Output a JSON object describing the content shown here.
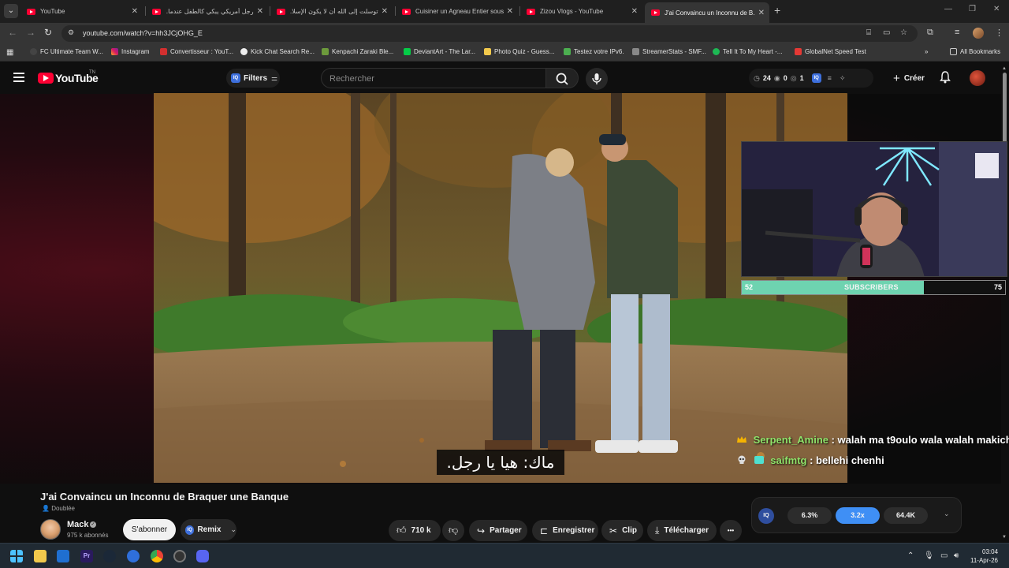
{
  "browser": {
    "tabs": [
      {
        "title": "YouTube",
        "active": false
      },
      {
        "title": "رجل أمريكي يبكي كالطفل عندما...",
        "active": false
      },
      {
        "title": "توسلت إلى الله أن لا يكون الإسلا...",
        "active": false
      },
      {
        "title": "Cuisiner un Agneau Entier sous...",
        "active": false
      },
      {
        "title": "Zizou Vlogs - YouTube",
        "active": false
      },
      {
        "title": "J'ai Convaincu un Inconnu de B...",
        "active": true
      }
    ],
    "new_tab": "+",
    "url": "youtube.com/watch?v=hh3JCjOHG_E",
    "bookmarks": [
      "FC Ultimate Team W...",
      "Instagram",
      "Convertisseur : YouT...",
      "Kick Chat Search Re...",
      "Kenpachi Zaraki Ble...",
      "DeviantArt - The Lar...",
      "Photo Quiz - Guess...",
      "Testez votre IPv6.",
      "StreamerStats - SMF...",
      "Tell It To My Heart -...",
      "GlobalNet Speed Test"
    ],
    "all_bookmarks": "All Bookmarks"
  },
  "masthead": {
    "logo_text": "YouTube",
    "country": "TN",
    "filters": "Filters",
    "search_placeholder": "Rechercher",
    "stats": {
      "a": "24",
      "b": "0",
      "c": "1"
    },
    "create": "Créer"
  },
  "overlay": {
    "sub_current": "52",
    "sub_label": "SUBSCRIBERS",
    "sub_goal": "75",
    "sub_progress": 0.693,
    "chat": [
      {
        "user": "Serpent_Amine",
        "text": " : walah ma t9oulo wala walah makich",
        "color": "#8fe36a"
      },
      {
        "user": "saifmtg",
        "text": " : bellehi chenhi",
        "color": "#8fe36a"
      }
    ],
    "subtitle": "ماك: هيا يا رجل."
  },
  "video": {
    "title": "J'ai Convaincu un Inconnu de Braquer une Banque",
    "dubbed": "Doublée",
    "channel": "Mack",
    "subscribers": "975 k abonnés",
    "subscribe": "S'abonner",
    "remix": "Remix",
    "likes": "710 k",
    "share": "Partager",
    "save": "Enregistrer",
    "clip": "Clip",
    "download": "Télécharger",
    "more": "•••"
  },
  "iq_panel": {
    "label": "IQ",
    "stat1": "6.3%",
    "stat2": "3.2x",
    "stat3": "64.4K"
  },
  "taskbar": {
    "time": "03:04",
    "date": "11-Apr-26"
  },
  "colors": {
    "youtube_red": "#ff0033",
    "iq_blue": "#3f8ff5",
    "sub_bar_fill": "#6ed3b0",
    "chat_name": "#8fe36a"
  }
}
